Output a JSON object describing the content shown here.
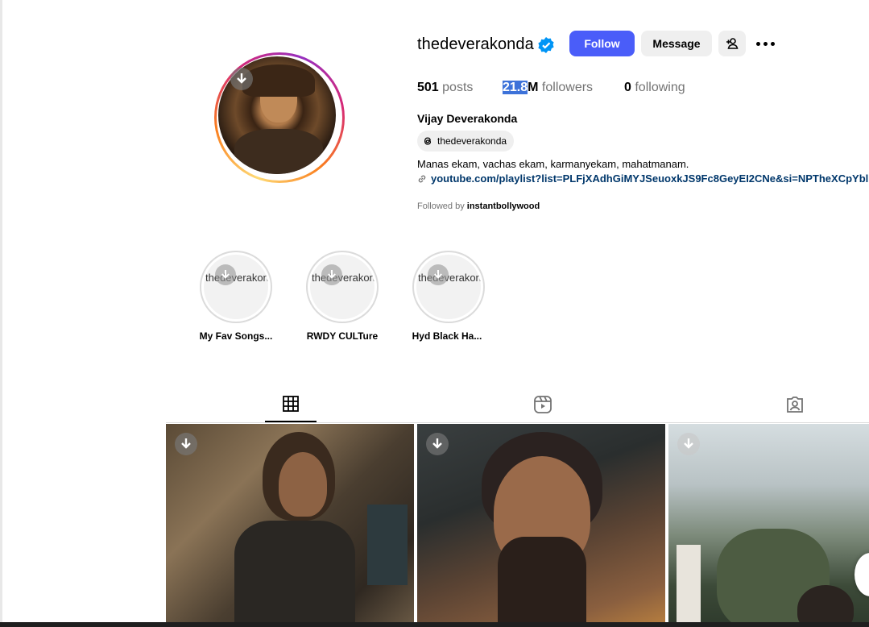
{
  "profile": {
    "username": "thedeverakonda",
    "verified": true,
    "buttons": {
      "follow": "Follow",
      "message": "Message"
    },
    "stats": {
      "posts_value": "501",
      "posts_label": "posts",
      "followers_value_selected": "21.8",
      "followers_value_rest": "M",
      "followers_label": "followers",
      "following_value": "0",
      "following_label": "following"
    },
    "full_name": "Vijay Deverakonda",
    "threads_handle": "thedeverakonda",
    "bio": "Manas ekam, vachas ekam, karmanyekam, mahatmanam.",
    "link": "youtube.com/playlist?list=PLFjXAdhGiMYJSeuoxkJS9Fc8GeyEI2CNe&si=NPTheXCpYbl",
    "followed_by_prefix": "Followed by",
    "followed_by_user": "instantbollywood"
  },
  "highlights": [
    {
      "alt": "thedeverakonda's highlight story picture",
      "label": "My Fav Songs..."
    },
    {
      "alt": "thedeverakonda's highlight story picture",
      "label": "RWDY CULTure"
    },
    {
      "alt": "thedeverakonda's highlight story picture",
      "label": "Hyd Black Ha..."
    }
  ],
  "tabs": [
    {
      "icon": "grid-icon",
      "active": true
    },
    {
      "icon": "reels-icon",
      "active": false
    },
    {
      "icon": "tagged-icon",
      "active": false
    }
  ],
  "colors": {
    "follow_button": "#4a5df9",
    "link": "#00376b",
    "verified": "#0095f6",
    "muted": "#737373"
  }
}
